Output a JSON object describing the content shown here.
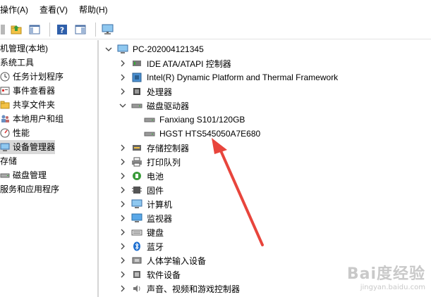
{
  "menubar": {
    "items": [
      "操作(A)",
      "查看(V)",
      "帮助(H)"
    ]
  },
  "toolbar": {
    "buttons": [
      "back-icon",
      "folder-up-icon",
      "show-hide-tree-icon",
      "help-icon",
      "properties-icon",
      "monitor-scan-icon"
    ]
  },
  "left_pane": {
    "items": [
      {
        "label": "机管理(本地)",
        "icon": "computer-management-icon"
      },
      {
        "label": "系统工具",
        "icon": ""
      },
      {
        "label": "任务计划程序",
        "icon": "task-scheduler-icon"
      },
      {
        "label": "事件查看器",
        "icon": "event-viewer-icon"
      },
      {
        "label": "共享文件夹",
        "icon": "shared-folder-icon"
      },
      {
        "label": "本地用户和组",
        "icon": "users-icon"
      },
      {
        "label": "性能",
        "icon": "performance-icon"
      },
      {
        "label": "设备管理器",
        "icon": "device-manager-icon"
      },
      {
        "label": "存储",
        "icon": ""
      },
      {
        "label": "磁盘管理",
        "icon": "disk-management-icon"
      },
      {
        "label": "服务和应用程序",
        "icon": ""
      }
    ]
  },
  "device_tree": {
    "root": "PC-202004121345",
    "categories": [
      {
        "label": "IDE ATA/ATAPI 控制器",
        "icon": "ide-controller-icon",
        "expanded": false
      },
      {
        "label": "Intel(R) Dynamic Platform and Thermal Framework",
        "icon": "chip-icon",
        "expanded": false
      },
      {
        "label": "处理器",
        "icon": "processor-icon",
        "expanded": false
      },
      {
        "label": "磁盘驱动器",
        "icon": "disk-drive-icon",
        "expanded": true,
        "children": [
          "Fanxiang S101/120GB",
          "HGST HTS545050A7E680"
        ]
      },
      {
        "label": "存储控制器",
        "icon": "storage-controller-icon",
        "expanded": false
      },
      {
        "label": "打印队列",
        "icon": "printer-icon",
        "expanded": false
      },
      {
        "label": "电池",
        "icon": "battery-icon",
        "expanded": false
      },
      {
        "label": "固件",
        "icon": "firmware-icon",
        "expanded": false
      },
      {
        "label": "计算机",
        "icon": "computer-icon",
        "expanded": false
      },
      {
        "label": "监视器",
        "icon": "monitor-icon",
        "expanded": false
      },
      {
        "label": "键盘",
        "icon": "keyboard-icon",
        "expanded": false
      },
      {
        "label": "蓝牙",
        "icon": "bluetooth-icon",
        "expanded": false
      },
      {
        "label": "人体学输入设备",
        "icon": "hid-icon",
        "expanded": false
      },
      {
        "label": "软件设备",
        "icon": "software-device-icon",
        "expanded": false
      },
      {
        "label": "声音、视频和游戏控制器",
        "icon": "sound-icon",
        "expanded": false
      }
    ]
  },
  "annotation": {
    "color": "#e8453c"
  },
  "watermark": {
    "main": "Bai度经验",
    "sub": "jingyan.baidu.com"
  }
}
